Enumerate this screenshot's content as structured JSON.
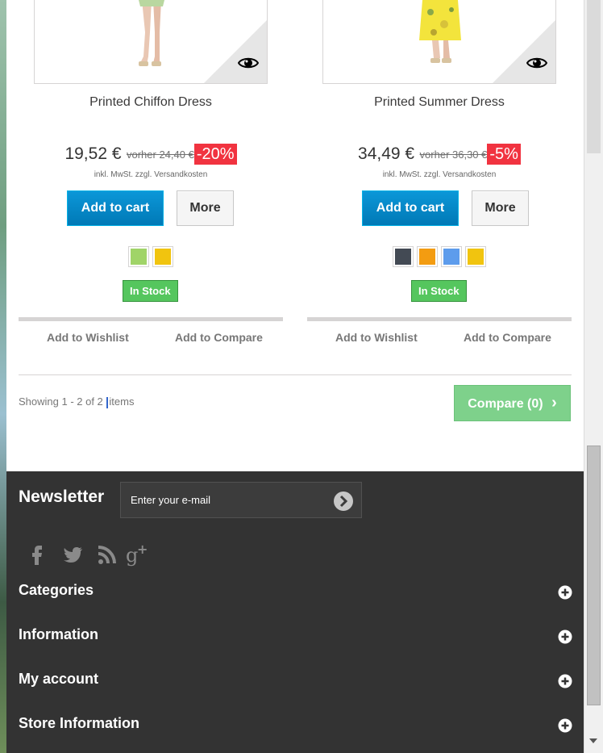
{
  "products": [
    {
      "name": "Printed Chiffon Dress",
      "price": "19,52 €",
      "old_price": "vorher 24,40 €",
      "discount": "-20%",
      "tax_note": "inkl. MwSt. zzgl. Versandkosten",
      "add_to_cart": "Add to cart",
      "more": "More",
      "colors": [
        "#A0D468",
        "#F1C40F"
      ],
      "stock": "In Stock",
      "wishlist": "Add to Wishlist",
      "compare": "Add to Compare"
    },
    {
      "name": "Printed Summer Dress",
      "price": "34,49 €",
      "old_price": "vorher 36,30 €",
      "discount": "-5%",
      "tax_note": "inkl. MwSt. zzgl. Versandkosten",
      "add_to_cart": "Add to cart",
      "more": "More",
      "colors": [
        "#434A54",
        "#F39C11",
        "#5D9CEC",
        "#F1C40F"
      ],
      "stock": "In Stock",
      "wishlist": "Add to Wishlist",
      "compare": "Add to Compare"
    }
  ],
  "pagination": {
    "showing_prefix": "Showing 1 - 2 of 2",
    "showing_suffix": "items",
    "compare_button": "Compare (0)",
    "compare_chevron": "›"
  },
  "footer": {
    "newsletter_title": "Newsletter",
    "newsletter_placeholder": "Enter your e-mail",
    "social": [
      "facebook-icon",
      "twitter-icon",
      "rss-icon",
      "google-plus-icon"
    ],
    "sections": [
      "Categories",
      "Information",
      "My account",
      "Store Information"
    ]
  },
  "colors": {
    "cart_blue": "#0079B6",
    "discount_red": "#F13340",
    "stock_green": "#55C65E",
    "compare_green": "#7ED18B",
    "footer_bg": "#333333"
  }
}
